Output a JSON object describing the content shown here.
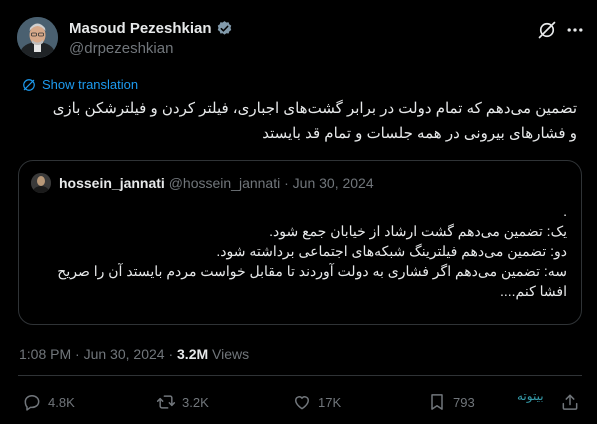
{
  "author": {
    "name": "Masoud Pezeshkian",
    "handle": "@drpezeshkian",
    "verified_color": "#829aab"
  },
  "header_icons": [
    "grok-icon",
    "more-icon"
  ],
  "translate_label": "Show translation",
  "tweet_text_lines": [
    "تضمین می‌دهم که تمام دولت در برابر  گشت‌های اجباری، فیلتر کردن و فیلترشکن بازی",
    "و فشارهای بیرونی در همه جلسات و تمام قد بایستد"
  ],
  "quote": {
    "name": "hossein_jannati",
    "handle": "@hossein_jannati",
    "separator": "·",
    "date": "Jun 30, 2024",
    "body_lines": [
      ".",
      "یک: تضمین می‌دهم گشت ارشاد از خیابان جمع شود.",
      "دو: تضمین می‌دهم فیلترینگ شبکه‌های اجتماعی برداشته شود.",
      "سه: تضمین می‌دهم اگر فشاری به دولت آوردند تا مقابل خواست مردم بایستد آن را صریح",
      "افشا کنم...."
    ]
  },
  "meta": {
    "time": "1:08 PM",
    "sep1": "·",
    "date": "Jun 30, 2024",
    "sep2": "·",
    "views_count": "3.2M",
    "views_label": "Views"
  },
  "actions": {
    "replies": "4.8K",
    "reposts": "3.2K",
    "likes": "17K",
    "bookmarks": "793"
  },
  "watermark": "بیتوته",
  "colors": {
    "background": "#000000",
    "text": "#e7e9ea",
    "secondary": "#71767b",
    "accent": "#1d9bf0",
    "border": "#2f3336"
  }
}
